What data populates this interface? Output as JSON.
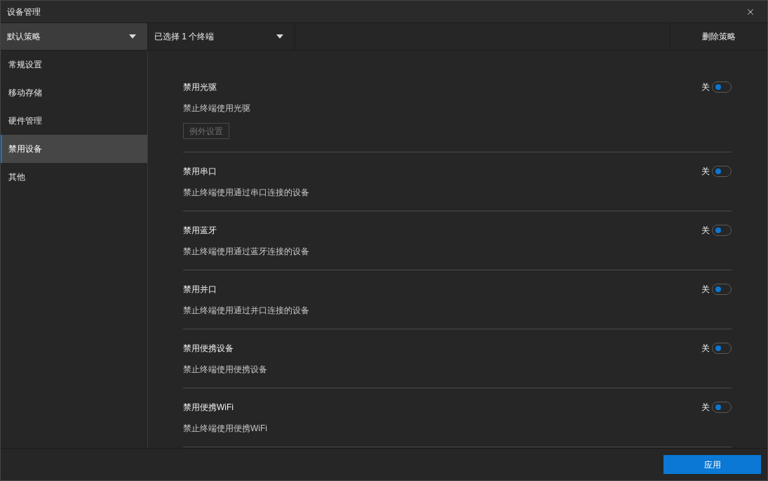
{
  "window": {
    "title": "设备管理"
  },
  "policy_dropdown": {
    "value": "默认策略"
  },
  "terminal_dropdown": {
    "value": "已选择 1 个终端"
  },
  "delete_button": {
    "label": "删除策略"
  },
  "sidebar": {
    "items": [
      {
        "label": "常规设置",
        "selected": false
      },
      {
        "label": "移动存储",
        "selected": false
      },
      {
        "label": "硬件管理",
        "selected": false
      },
      {
        "label": "禁用设备",
        "selected": true
      },
      {
        "label": "其他",
        "selected": false
      }
    ]
  },
  "settings": [
    {
      "title": "禁用光驱",
      "description": "禁止终端使用光驱",
      "switch_label": "关",
      "on": false,
      "exception_button": {
        "label": "例外设置",
        "disabled": true
      }
    },
    {
      "title": "禁用串口",
      "description": "禁止终端使用通过串口连接的设备",
      "switch_label": "关",
      "on": false
    },
    {
      "title": "禁用蓝牙",
      "description": "禁止终端使用通过蓝牙连接的设备",
      "switch_label": "关",
      "on": false
    },
    {
      "title": "禁用并口",
      "description": "禁止终端使用通过并口连接的设备",
      "switch_label": "关",
      "on": false
    },
    {
      "title": "禁用便携设备",
      "description": "禁止终端使用便携设备",
      "switch_label": "关",
      "on": false
    },
    {
      "title": "禁用便携WiFi",
      "description": "禁止终端使用便携WiFi",
      "switch_label": "关",
      "on": false
    }
  ],
  "apply_button": {
    "label": "应用"
  }
}
